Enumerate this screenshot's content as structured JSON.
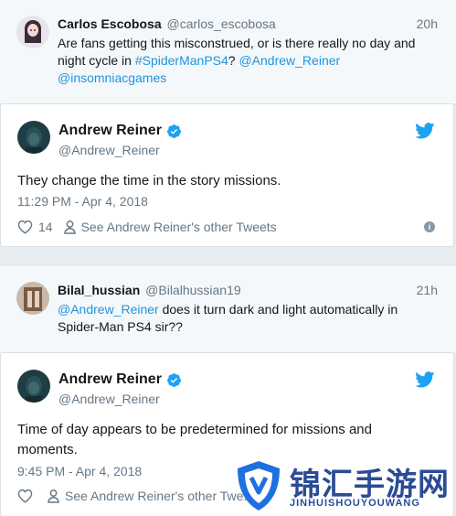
{
  "reply1": {
    "name": "Carlos Escobosa",
    "handle": "@carlos_escobosa",
    "time": "20h",
    "text_plain": "Are fans getting this misconstrued, or is there really no day and night cycle in ",
    "hashtag": "#SpiderManPS4",
    "mention1": "@Andrew_Reiner",
    "mention2": "@insomniacgames"
  },
  "tweet1": {
    "name": "Andrew Reiner",
    "handle": "@Andrew_Reiner",
    "text": "They change the time in the story missions.",
    "timestamp": "11:29 PM - Apr 4, 2018",
    "likes": "14",
    "other_tweets": "See Andrew Reiner's other Tweets"
  },
  "reply2": {
    "name": "Bilal_hussian",
    "handle": "@Bilalhussian19",
    "time": "21h",
    "mention": "@Andrew_Reiner",
    "text_plain": " does it turn dark and light automatically in Spider-Man PS4 sir??"
  },
  "tweet2": {
    "name": "Andrew Reiner",
    "handle": "@Andrew_Reiner",
    "text": "Time of day appears to be predetermined for missions and moments.",
    "timestamp": "9:45 PM - Apr 4, 2018",
    "other_tweets": "See Andrew Reiner's other Twe..."
  },
  "watermark": {
    "title": "锦汇手游网",
    "subtitle": "JINHUISHOUYOUWANG"
  },
  "colors": {
    "link": "#1b95e0",
    "twitter_blue": "#1da1f2",
    "muted": "#657786",
    "reply_bg": "#f5f8fa",
    "page_bg": "#e6ecf0"
  },
  "icons": [
    "twitter-bird-icon",
    "verified-badge-icon",
    "heart-icon",
    "person-icon",
    "info-icon"
  ]
}
